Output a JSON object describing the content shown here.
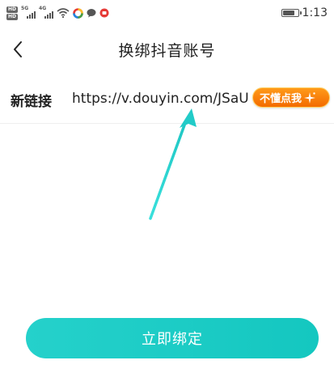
{
  "status_bar": {
    "hd_badges": [
      "HD",
      "HD"
    ],
    "signal_tags": [
      "5G",
      "4G"
    ],
    "battery_level": 0.8,
    "time": "1:13"
  },
  "nav": {
    "title": "换绑抖音账号",
    "back_icon": "chevron-left-icon"
  },
  "link_field": {
    "label": "新链接",
    "value": "https://v.douyin.com/JSaUE"
  },
  "help_badge": {
    "label": "不懂点我",
    "icon": "sparkle-icon",
    "color": "#f36b00"
  },
  "bind_button": {
    "label": "立即绑定",
    "color": "#1ccbc4"
  },
  "annotation": {
    "arrow_color": "#2ad3d0"
  }
}
